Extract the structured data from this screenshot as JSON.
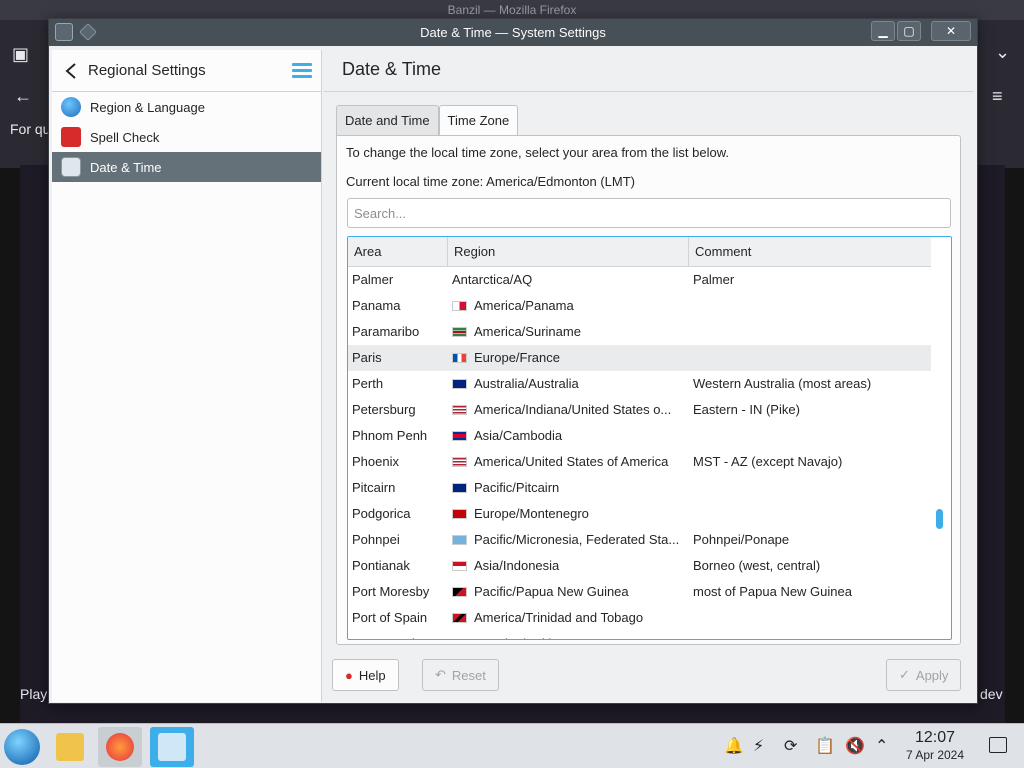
{
  "background": {
    "firefox_title": "Banzil — Mozilla Firefox",
    "text_left_top": "For qu",
    "text_left_bottom": "Play",
    "text_right_bottom": "dev"
  },
  "window": {
    "title": "Date & Time — System Settings",
    "buttons": {
      "minimize": "▁",
      "maximize": "▢",
      "close": "✕"
    }
  },
  "sidebar": {
    "header": "Regional Settings",
    "items": [
      {
        "label": "Region & Language",
        "icon": "globe-icon"
      },
      {
        "label": "Spell Check",
        "icon": "spell-check-icon"
      },
      {
        "label": "Date & Time",
        "icon": "date-time-icon",
        "active": true
      }
    ]
  },
  "main": {
    "title": "Date & Time",
    "tabs": [
      {
        "label": "Date and Time",
        "selected": false
      },
      {
        "label": "Time Zone",
        "selected": true
      }
    ],
    "instruction": "To change the local time zone, select your area from the list below.",
    "current_zone": "Current local time zone: America/Edmonton (LMT)",
    "search": {
      "placeholder": "Search...",
      "value": ""
    },
    "columns": [
      "Area",
      "Region",
      "Comment"
    ],
    "rows": [
      {
        "area": "Palmer",
        "region": "Antarctica/AQ",
        "comment": "Palmer",
        "flag": ""
      },
      {
        "area": "Panama",
        "region": "America/Panama",
        "comment": "",
        "flag": "panama"
      },
      {
        "area": "Paramaribo",
        "region": "America/Suriname",
        "comment": "",
        "flag": "suriname"
      },
      {
        "area": "Paris",
        "region": "Europe/France",
        "comment": "",
        "flag": "france",
        "highlighted": true
      },
      {
        "area": "Perth",
        "region": "Australia/Australia",
        "comment": "Western Australia (most areas)",
        "flag": "australia"
      },
      {
        "area": "Petersburg",
        "region": "America/Indiana/United States o...",
        "comment": "Eastern - IN (Pike)",
        "flag": "usa"
      },
      {
        "area": "Phnom Penh",
        "region": "Asia/Cambodia",
        "comment": "",
        "flag": "cambodia"
      },
      {
        "area": "Phoenix",
        "region": "America/United States of America",
        "comment": "MST - AZ (except Navajo)",
        "flag": "usa"
      },
      {
        "area": "Pitcairn",
        "region": "Pacific/Pitcairn",
        "comment": "",
        "flag": "pitcairn"
      },
      {
        "area": "Podgorica",
        "region": "Europe/Montenegro",
        "comment": "",
        "flag": "montenegro"
      },
      {
        "area": "Pohnpei",
        "region": "Pacific/Micronesia, Federated Sta...",
        "comment": "Pohnpei/Ponape",
        "flag": "micronesia"
      },
      {
        "area": "Pontianak",
        "region": "Asia/Indonesia",
        "comment": "Borneo (west, central)",
        "flag": "indonesia"
      },
      {
        "area": "Port Moresby",
        "region": "Pacific/Papua New Guinea",
        "comment": "most of Papua New Guinea",
        "flag": "png"
      },
      {
        "area": "Port of Spain",
        "region": "America/Trinidad and Tobago",
        "comment": "",
        "flag": "trinidad"
      },
      {
        "area": "Port-au-Prince",
        "region": "America/Haiti",
        "comment": "",
        "flag": "haiti"
      }
    ],
    "buttons": {
      "help": "Help",
      "reset": "Reset",
      "apply": "Apply"
    }
  },
  "taskbar": {
    "time": "12:07",
    "date": "7 Apr 2024"
  },
  "colors": {
    "accent": "#3daee9",
    "active_item": "#657179",
    "titlebar": "#475057"
  }
}
